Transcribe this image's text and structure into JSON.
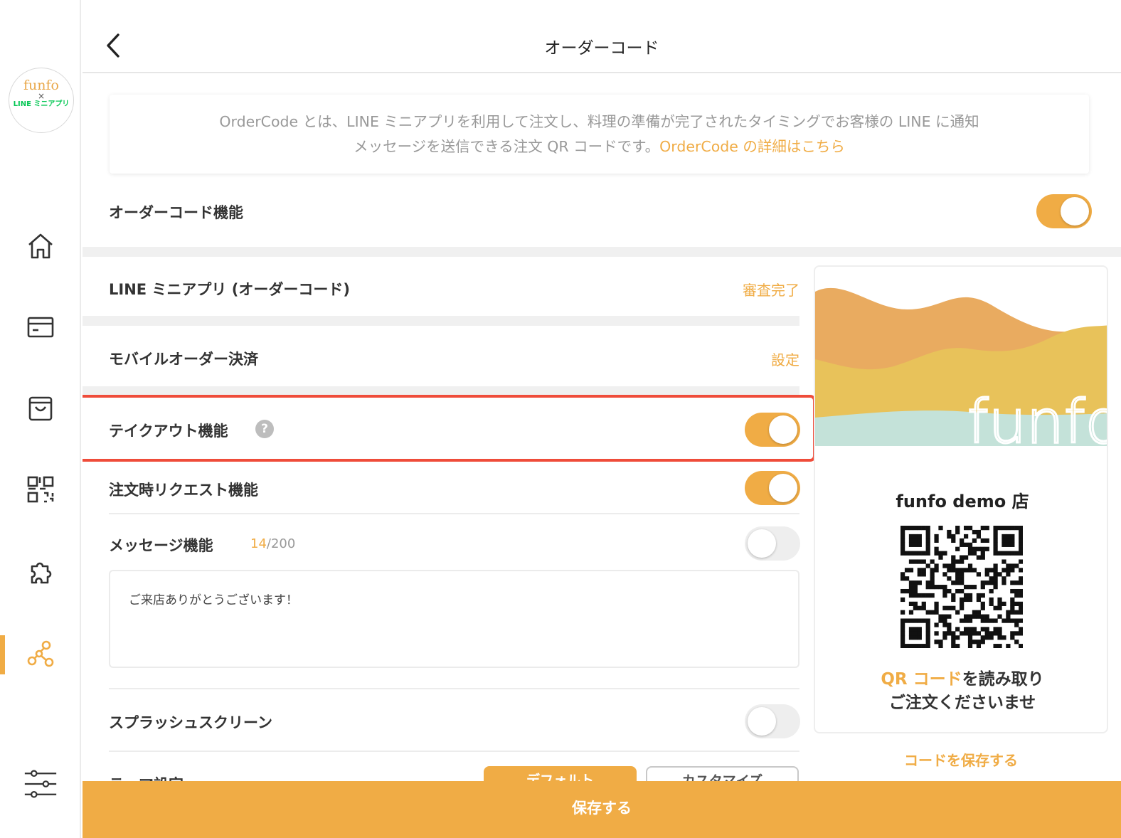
{
  "sidebar": {
    "logo_line1": "funfo",
    "logo_line2": "×",
    "logo_line3": "LINE ミニアプリ",
    "items": [
      {
        "icon": "home-icon"
      },
      {
        "icon": "card-icon"
      },
      {
        "icon": "shopping-bag-icon"
      },
      {
        "icon": "qr-code-icon"
      },
      {
        "icon": "puzzle-icon"
      },
      {
        "icon": "network-icon",
        "active": true
      },
      {
        "icon": "sliders-icon"
      }
    ]
  },
  "header": {
    "title": "オーダーコード"
  },
  "info": {
    "text_line1": "OrderCode とは、LINE ミニアプリを利用して注文し、料理の準備が完了されたタイミングでお客様の LINE に通知",
    "text_line2": "メッセージを送信できる注文 QR コードです。",
    "link_text": "OrderCode の詳細はこちら"
  },
  "settings": {
    "ordercode_label": "オーダーコード機能",
    "ordercode_on": true,
    "line_mini_label": "LINE ミニアプリ (オーダーコード)",
    "line_mini_status": "審査完了",
    "mobile_pay_label": "モバイルオーダー決済",
    "mobile_pay_action": "設定",
    "takeout_label": "テイクアウト機能",
    "takeout_help": "?",
    "takeout_on": true,
    "request_label": "注文時リクエスト機能",
    "request_on": true,
    "message_label": "メッセージ機能",
    "message_count": "14",
    "message_max": "/200",
    "message_on": false,
    "message_text": "ご来店ありがとうございます！",
    "splash_label": "スプラッシュスクリーン",
    "splash_on": false,
    "theme_label": "テーマ設定",
    "theme_default": "デフォルト",
    "theme_custom": "カスタマイズ"
  },
  "preview": {
    "brand": "funfo",
    "store_name": "funfo demo 店",
    "caption_highlight": "QR コード",
    "caption_rest": "を読み取り",
    "caption_line2": "ご注文くださいませ",
    "save_code": "コードを保存する",
    "colors": {
      "orange": "#e9a85a",
      "yellow": "#e8c25a",
      "teal": "#bfe0d8"
    }
  },
  "footer": {
    "save_label": "保存する"
  },
  "colors": {
    "accent": "#f0ac45",
    "highlight_border": "#ef4c3a"
  }
}
